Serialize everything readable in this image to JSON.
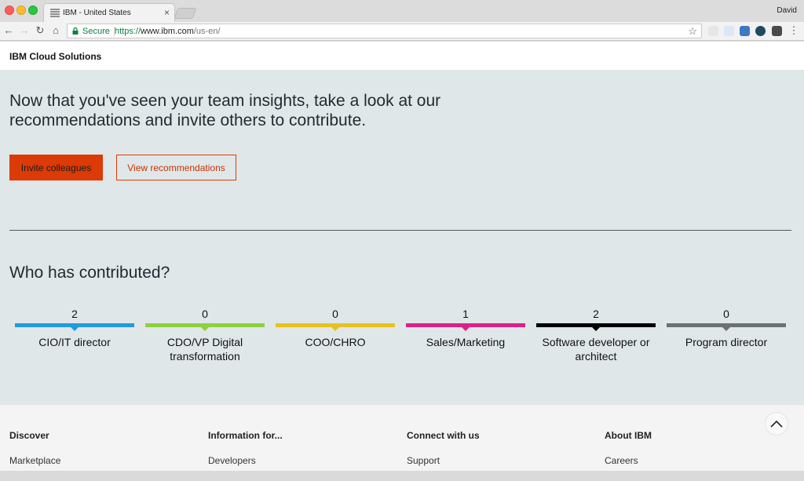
{
  "browser": {
    "tab_title": "IBM - United States",
    "tab_close": "×",
    "profile_name": "David",
    "secure_label": "Secure",
    "url_scheme": "https://",
    "url_host": "www.ibm.com",
    "url_path": "/us-en/",
    "icons": [
      "back-icon",
      "forward-icon",
      "reload-icon",
      "home-icon",
      "lock-icon",
      "star-icon",
      "menu-icon"
    ]
  },
  "masthead": {
    "brand": "IBM Cloud Solutions"
  },
  "hero": {
    "headline": "Now that you've seen your team insights, take a look at our recommendations and invite others to contribute.",
    "invite_label": "Invite colleagues",
    "recommend_label": "View recommendations"
  },
  "contributors": {
    "title": "Who has contributed?",
    "roles": [
      {
        "count": "2",
        "label": "CIO/IT director",
        "color": "#1f9bde"
      },
      {
        "count": "0",
        "label": "CDO/VP Digital transformation",
        "color": "#8cd13e"
      },
      {
        "count": "0",
        "label": "COO/CHRO",
        "color": "#e6c21f"
      },
      {
        "count": "1",
        "label": "Sales/Marketing",
        "color": "#df1f88"
      },
      {
        "count": "2",
        "label": "Software developer or architect",
        "color": "#000000"
      },
      {
        "count": "0",
        "label": "Program director",
        "color": "#6c7071"
      }
    ]
  },
  "footer": {
    "columns": [
      {
        "heading": "Discover",
        "link": "Marketplace"
      },
      {
        "heading": "Information for...",
        "link": "Developers"
      },
      {
        "heading": "Connect with us",
        "link": "Support"
      },
      {
        "heading": "About IBM",
        "link": "Careers"
      }
    ]
  },
  "colors": {
    "accent": "#dc3a06",
    "page_bg": "#e0e7e8",
    "footer_bg": "#f4f4f4",
    "secure_green": "#0b8043"
  }
}
